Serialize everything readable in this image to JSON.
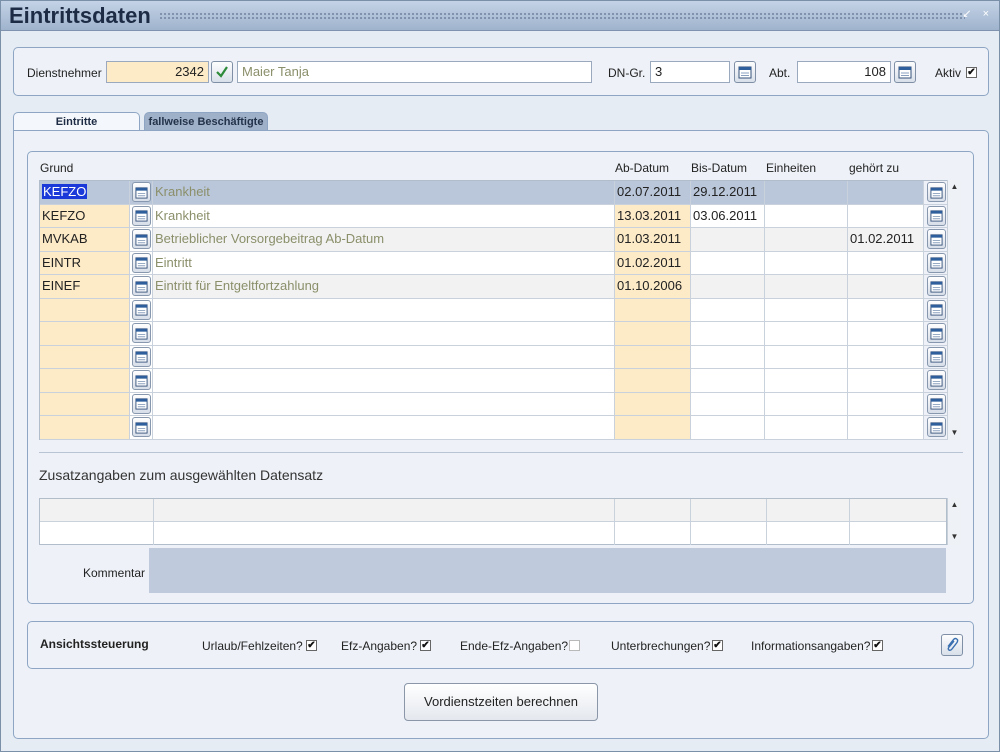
{
  "window": {
    "title": "Eintrittsdaten",
    "controls": "↙ ×"
  },
  "header": {
    "employee_label": "Dienstnehmer",
    "employee_number": "2342",
    "employee_name": "Maier Tanja",
    "dngr_label": "DN-Gr.",
    "dngr_value": "3",
    "abt_label": "Abt.",
    "abt_value": "108",
    "aktiv_label": "Aktiv",
    "aktiv_checked": "✔"
  },
  "tabs": [
    {
      "label": "Eintritte",
      "active": true
    },
    {
      "label": "fallweise Beschäftigte",
      "active": false
    }
  ],
  "table": {
    "columns": {
      "grund": "Grund",
      "ab": "Ab-Datum",
      "bis": "Bis-Datum",
      "einheiten": "Einheiten",
      "gehoert": "gehört zu"
    },
    "rows": [
      {
        "code": "KEFZO",
        "desc": "Krankheit",
        "ab": "02.07.2011",
        "bis": "29.12.2011",
        "einheiten": "",
        "gehoert": ""
      },
      {
        "code": "KEFZO",
        "desc": "Krankheit",
        "ab": "13.03.2011",
        "bis": "03.06.2011",
        "einheiten": "",
        "gehoert": ""
      },
      {
        "code": "MVKAB",
        "desc": "Betrieblicher Vorsorgebeitrag Ab-Datum",
        "ab": "01.03.2011",
        "bis": "",
        "einheiten": "",
        "gehoert": "01.02.2011"
      },
      {
        "code": "EINTR",
        "desc": "Eintritt",
        "ab": "01.02.2011",
        "bis": "",
        "einheiten": "",
        "gehoert": ""
      },
      {
        "code": "EINEF",
        "desc": "Eintritt für Entgeltfortzahlung",
        "ab": "01.10.2006",
        "bis": "",
        "einheiten": "",
        "gehoert": ""
      },
      {
        "code": "",
        "desc": "",
        "ab": "",
        "bis": "",
        "einheiten": "",
        "gehoert": ""
      },
      {
        "code": "",
        "desc": "",
        "ab": "",
        "bis": "",
        "einheiten": "",
        "gehoert": ""
      },
      {
        "code": "",
        "desc": "",
        "ab": "",
        "bis": "",
        "einheiten": "",
        "gehoert": ""
      },
      {
        "code": "",
        "desc": "",
        "ab": "",
        "bis": "",
        "einheiten": "",
        "gehoert": ""
      },
      {
        "code": "",
        "desc": "",
        "ab": "",
        "bis": "",
        "einheiten": "",
        "gehoert": ""
      },
      {
        "code": "",
        "desc": "",
        "ab": "",
        "bis": "",
        "einheiten": "",
        "gehoert": ""
      }
    ]
  },
  "details": {
    "title": "Zusatzangaben zum ausgewählten Datensatz",
    "comment_label": "Kommentar"
  },
  "view": {
    "title": "Ansichtssteuerung",
    "options": [
      {
        "label": "Urlaub/Fehlzeiten?",
        "mark": "✔"
      },
      {
        "label": "Efz-Angaben?",
        "mark": "✔"
      },
      {
        "label": "Ende-Efz-Angaben?",
        "mark": ""
      },
      {
        "label": "Unterbrechungen?",
        "mark": "✔"
      },
      {
        "label": "Informationsangaben?",
        "mark": "✔"
      }
    ]
  },
  "actions": {
    "calculate_label": "Vordienstzeiten berechnen"
  },
  "icons": {
    "row_button": "calendar-icon",
    "validate": "checkmark-icon",
    "attachment": "paperclip-icon"
  }
}
